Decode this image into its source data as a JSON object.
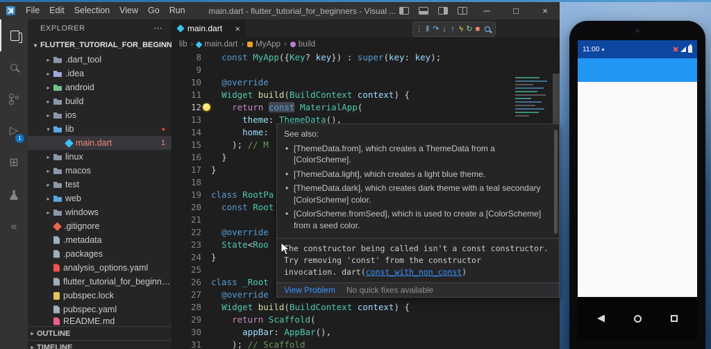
{
  "colors": {
    "accent": "#0e70c0",
    "error_red": "#f14c4c",
    "link_blue": "#3794ff",
    "status_bar_blue": "#0d47a1",
    "app_bar_blue": "#2196f3",
    "dart_icon_blue": "#3ac2f0"
  },
  "titlebar": {
    "menu": [
      {
        "label": "File"
      },
      {
        "label": "Edit"
      },
      {
        "label": "Selection"
      },
      {
        "label": "View"
      },
      {
        "label": "Go"
      },
      {
        "label": "Run"
      }
    ],
    "title": "main.dart - flutter_tutorial_for_beginners - Visual ...",
    "controls": [
      {
        "name": "minimize",
        "glyph": "─"
      },
      {
        "name": "maximize",
        "glyph": "□"
      },
      {
        "name": "close",
        "glyph": "×"
      }
    ]
  },
  "activity": {
    "debug_badge": "1"
  },
  "explorer": {
    "title": "EXPLORER",
    "actions": "⋯",
    "root": {
      "chev": "▾",
      "label": "FLUTTER_TUTORIAL_FOR_BEGINNERS"
    },
    "items": [
      {
        "ind": 1,
        "chev": "▸",
        "icon": "folder",
        "color": "#8a98a8",
        "label": ".dart_tool"
      },
      {
        "ind": 1,
        "chev": "▸",
        "icon": "folder",
        "color": "#9fa8da",
        "label": ".idea"
      },
      {
        "ind": 1,
        "chev": "▸",
        "icon": "folder",
        "color": "#71c287",
        "label": "android"
      },
      {
        "ind": 1,
        "chev": "▸",
        "icon": "folder",
        "color": "#8a98a8",
        "label": "build"
      },
      {
        "ind": 1,
        "chev": "▸",
        "icon": "folder",
        "color": "#8a98a8",
        "label": "ios"
      },
      {
        "ind": 1,
        "chev": "▾",
        "icon": "folder",
        "color": "#5ba7e0",
        "label": "lib",
        "dot": "●"
      },
      {
        "ind": 2,
        "chev": "",
        "icon": "dart",
        "color": "#3ac2f0",
        "label": "main.dart",
        "sel": true,
        "lblColor": "#f48771",
        "badge": "1"
      },
      {
        "ind": 1,
        "chev": "▸",
        "icon": "folder",
        "color": "#8a98a8",
        "label": "linux"
      },
      {
        "ind": 1,
        "chev": "▸",
        "icon": "folder",
        "color": "#8a98a8",
        "label": "macos"
      },
      {
        "ind": 1,
        "chev": "▸",
        "icon": "folder",
        "color": "#8a98a8",
        "label": "test"
      },
      {
        "ind": 1,
        "chev": "▸",
        "icon": "folder",
        "color": "#5ba7e0",
        "label": "web"
      },
      {
        "ind": 1,
        "chev": "▸",
        "icon": "folder",
        "color": "#8a98a8",
        "label": "windows"
      },
      {
        "ind": 1,
        "chev": "",
        "icon": "git",
        "color": "#e8694a",
        "label": ".gitignore"
      },
      {
        "ind": 1,
        "chev": "",
        "icon": "file",
        "color": "#9fb0bb",
        "label": ".metadata"
      },
      {
        "ind": 1,
        "chev": "",
        "icon": "file",
        "color": "#9fb0bb",
        "label": ".packages"
      },
      {
        "ind": 1,
        "chev": "",
        "icon": "file",
        "color": "#ef5350",
        "label": "analysis_options.yaml"
      },
      {
        "ind": 1,
        "chev": "",
        "icon": "file",
        "color": "#9fb0bb",
        "label": "flutter_tutorial_for_beginner…"
      },
      {
        "ind": 1,
        "chev": "",
        "icon": "lock",
        "color": "#e6c25a",
        "label": "pubspec.lock"
      },
      {
        "ind": 1,
        "chev": "",
        "icon": "file",
        "color": "#9fb0bb",
        "label": "pubspec.yaml"
      },
      {
        "ind": 1,
        "chev": "",
        "icon": "file",
        "color": "#ec5f87",
        "label": "README.md",
        "clip": true
      }
    ],
    "sections": [
      {
        "label": "OUTLINE"
      },
      {
        "label": "TIMELINE"
      }
    ]
  },
  "tabs": [
    {
      "label": "main.dart",
      "close": "×"
    }
  ],
  "breadcrumbs": {
    "sep": "›",
    "items": [
      {
        "label": "lib",
        "icon": ""
      },
      {
        "label": "main.dart",
        "icon": "dart"
      },
      {
        "label": "MyApp",
        "icon": "class"
      },
      {
        "label": "build",
        "icon": "method"
      }
    ]
  },
  "debugbar": {
    "icons": [
      {
        "name": "grip",
        "glyph": "⋮⋮",
        "color": "#8b8b8b"
      },
      {
        "name": "pause",
        "glyph": "‖",
        "color": "#75beff"
      },
      {
        "name": "step-over",
        "glyph": "↷",
        "color": "#75beff"
      },
      {
        "name": "step-into",
        "glyph": "↓",
        "color": "#75beff"
      },
      {
        "name": "step-out",
        "glyph": "↑",
        "color": "#75beff"
      },
      {
        "name": "hot-reload",
        "glyph": "ϟ",
        "color": "#ffd54f"
      },
      {
        "name": "restart",
        "glyph": "↻",
        "color": "#89d185"
      },
      {
        "name": "stop",
        "glyph": "■",
        "color": "#f48771"
      },
      {
        "name": "inspect-widget",
        "glyph": "",
        "color": "#75beff"
      }
    ]
  },
  "code": {
    "lines": [
      {
        "n": "8",
        "toks": [
          [
            "  ",
            "p"
          ],
          [
            "const",
            "k"
          ],
          [
            " ",
            "p"
          ],
          [
            "MyApp",
            "t"
          ],
          [
            "({",
            "p"
          ],
          [
            "Key",
            "t"
          ],
          [
            "? ",
            "p"
          ],
          [
            "key",
            "v"
          ],
          [
            "}) : ",
            "p"
          ],
          [
            "super",
            "k"
          ],
          [
            "(",
            "p"
          ],
          [
            "key",
            "v"
          ],
          [
            ": ",
            "p"
          ],
          [
            "key",
            "v"
          ],
          [
            ");",
            "p"
          ]
        ]
      },
      {
        "n": "9",
        "toks": []
      },
      {
        "n": "10",
        "toks": [
          [
            "  ",
            "p"
          ],
          [
            "@override",
            "k"
          ]
        ]
      },
      {
        "n": "11",
        "toks": [
          [
            "  ",
            "p"
          ],
          [
            "Widget",
            "t"
          ],
          [
            " ",
            "p"
          ],
          [
            "build",
            "f"
          ],
          [
            "(",
            "p"
          ],
          [
            "BuildContext",
            "t"
          ],
          [
            " ",
            "p"
          ],
          [
            "context",
            "v"
          ],
          [
            ") {",
            "p"
          ]
        ]
      },
      {
        "n": "12",
        "cur": true,
        "toks": [
          [
            "    ",
            "p"
          ],
          [
            "return",
            "c"
          ],
          [
            " ",
            "p"
          ],
          [
            "const",
            "kh"
          ],
          [
            " ",
            "p"
          ],
          [
            "MaterialApp",
            "t"
          ],
          [
            "(",
            "p"
          ]
        ]
      },
      {
        "n": "13",
        "toks": [
          [
            "      ",
            "p"
          ],
          [
            "theme",
            "v"
          ],
          [
            ": ",
            "p"
          ],
          [
            "ThemeData",
            "tu"
          ],
          [
            "(),",
            "p"
          ]
        ]
      },
      {
        "n": "14",
        "toks": [
          [
            "      ",
            "p"
          ],
          [
            "home",
            "v"
          ],
          [
            ":",
            "p"
          ]
        ]
      },
      {
        "n": "15",
        "toks": [
          [
            "    ",
            "p"
          ],
          [
            "); ",
            "p"
          ],
          [
            "// M",
            "m"
          ]
        ]
      },
      {
        "n": "16",
        "toks": [
          [
            "  ",
            "p"
          ],
          [
            "}",
            "p"
          ]
        ]
      },
      {
        "n": "17",
        "toks": [
          [
            "}",
            "p"
          ]
        ]
      },
      {
        "n": "18",
        "toks": []
      },
      {
        "n": "19",
        "toks": [
          [
            "class",
            "k"
          ],
          [
            " ",
            "p"
          ],
          [
            "RootPa",
            "t"
          ]
        ]
      },
      {
        "n": "20",
        "toks": [
          [
            "  ",
            "p"
          ],
          [
            "const",
            "k"
          ],
          [
            " ",
            "p"
          ],
          [
            "Root",
            "t"
          ]
        ]
      },
      {
        "n": "21",
        "toks": []
      },
      {
        "n": "22",
        "toks": [
          [
            "  ",
            "p"
          ],
          [
            "@override",
            "k"
          ]
        ]
      },
      {
        "n": "23",
        "toks": [
          [
            "  ",
            "p"
          ],
          [
            "State",
            "t"
          ],
          [
            "<",
            "p"
          ],
          [
            "Roo",
            "t"
          ]
        ]
      },
      {
        "n": "24",
        "toks": [
          [
            "}",
            "p"
          ]
        ]
      },
      {
        "n": "25",
        "toks": []
      },
      {
        "n": "26",
        "toks": [
          [
            "class",
            "k"
          ],
          [
            " ",
            "p"
          ],
          [
            "_Root",
            "t"
          ]
        ]
      },
      {
        "n": "27",
        "toks": [
          [
            "  ",
            "p"
          ],
          [
            "@override",
            "k"
          ]
        ]
      },
      {
        "n": "28",
        "toks": [
          [
            "  ",
            "p"
          ],
          [
            "Widget",
            "t"
          ],
          [
            " ",
            "p"
          ],
          [
            "build",
            "f"
          ],
          [
            "(",
            "p"
          ],
          [
            "BuildContext",
            "t"
          ],
          [
            " ",
            "p"
          ],
          [
            "context",
            "v"
          ],
          [
            ") {",
            "p"
          ]
        ]
      },
      {
        "n": "29",
        "toks": [
          [
            "    ",
            "p"
          ],
          [
            "return",
            "c"
          ],
          [
            " ",
            "p"
          ],
          [
            "Scaffold",
            "t"
          ],
          [
            "(",
            "p"
          ]
        ]
      },
      {
        "n": "30",
        "toks": [
          [
            "      ",
            "p"
          ],
          [
            "appBar",
            "v"
          ],
          [
            ": ",
            "p"
          ],
          [
            "AppBar",
            "t"
          ],
          [
            "(),",
            "p"
          ]
        ]
      },
      {
        "n": "31",
        "toks": [
          [
            "    ",
            "p"
          ],
          [
            "); ",
            "p"
          ],
          [
            "// Scaffold",
            "m"
          ]
        ]
      }
    ]
  },
  "hover": {
    "see_also": "See also:",
    "bullets": [
      "[ThemeData.from], which creates a ThemeData from a [ColorScheme].",
      "[ThemeData.light], which creates a light blue theme.",
      "[ThemeData.dark], which creates dark theme with a teal secondary [ColorScheme] color.",
      "[ColorScheme.fromSeed], which is used to create a [ColorScheme] from a seed color."
    ],
    "error": {
      "line1": "The constructor being called isn't a const constructor.",
      "line2": "Try removing 'const' from the constructor",
      "line3_prefix": "invocation. dart(",
      "link": "const_with_non_const",
      "line3_suffix": ")"
    },
    "actions": {
      "view_problem": "View Problem",
      "no_fixes": "No quick fixes available"
    }
  },
  "emulator": {
    "time": "11:00"
  }
}
